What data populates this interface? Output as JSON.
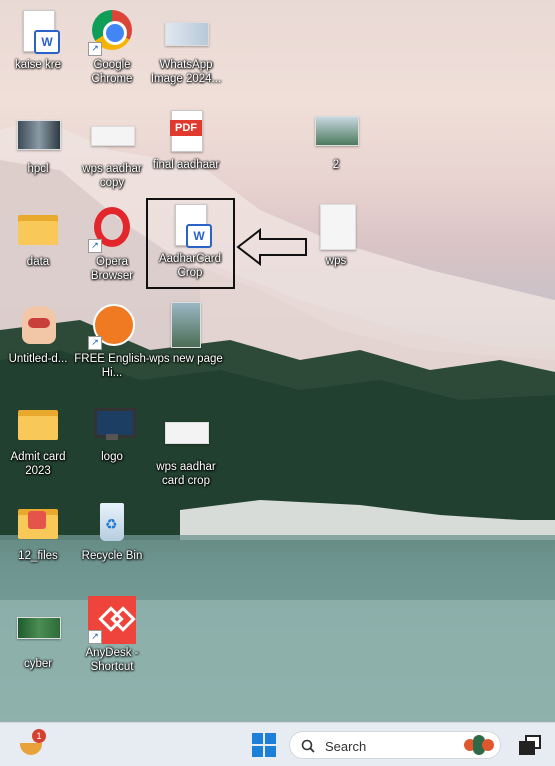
{
  "desktop": {
    "icons": [
      {
        "label": "kaise kre"
      },
      {
        "label": "Google Chrome"
      },
      {
        "label": "WhatsApp Image 2024..."
      },
      {
        "label": "hpcl"
      },
      {
        "label": "wps aadhar copy"
      },
      {
        "label": "final aadhaar"
      },
      {
        "label": "2"
      },
      {
        "label": "data"
      },
      {
        "label": "Opera Browser"
      },
      {
        "label": "AadharCard Crop"
      },
      {
        "label": "wps"
      },
      {
        "label": "Untitled-d..."
      },
      {
        "label": "FREE English-Hi..."
      },
      {
        "label": "wps new page"
      },
      {
        "label": "Admit card 2023"
      },
      {
        "label": "logo"
      },
      {
        "label": "wps aadhar card crop"
      },
      {
        "label": "12_files"
      },
      {
        "label": "Recycle Bin"
      },
      {
        "label": "cyber"
      },
      {
        "label": "AnyDesk - Shortcut"
      }
    ],
    "pdf_badge": "PDF",
    "word_badge": "W"
  },
  "taskbar": {
    "notification_count": "1",
    "search_label": "Search"
  }
}
